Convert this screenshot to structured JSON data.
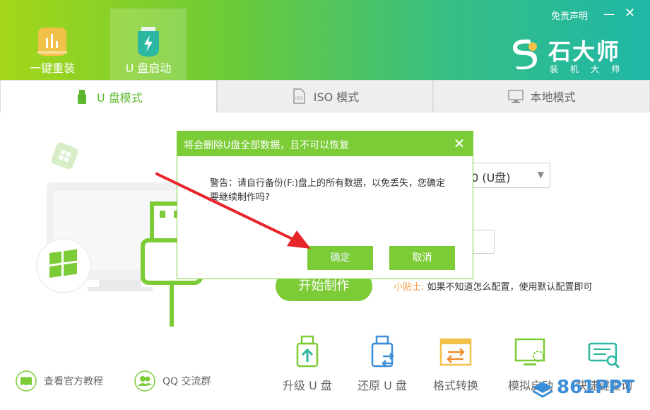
{
  "header": {
    "nav": [
      {
        "label": "一键重装",
        "icon": "bar-chart-icon"
      },
      {
        "label": "U 盘启动",
        "icon": "usb-lightning-icon"
      }
    ],
    "disclaimer": "免责声明",
    "minimize": "—",
    "close": "✕",
    "brand": {
      "name": "石大师",
      "sub": "装机大师"
    }
  },
  "tabs": [
    {
      "label": "U 盘模式",
      "icon": "usb-icon",
      "active": true
    },
    {
      "label": "ISO 模式",
      "icon": "iso-file-icon",
      "active": false
    },
    {
      "label": "本地模式",
      "icon": "monitor-icon",
      "active": false
    }
  ],
  "main": {
    "device_select": ".0 (U盘)",
    "start_button": "开始制作",
    "tip_label": "小贴士:",
    "tip_text": "如果不知道怎么配置，使用默认配置即可"
  },
  "bottom_links": [
    {
      "label": "查看官方教程",
      "icon": "book-icon"
    },
    {
      "label": "QQ 交流群",
      "icon": "group-icon"
    }
  ],
  "tools": [
    {
      "label": "升级 U 盘",
      "icon": "usb-upgrade-icon"
    },
    {
      "label": "还原 U 盘",
      "icon": "usb-restore-icon"
    },
    {
      "label": "格式转换",
      "icon": "format-convert-icon"
    },
    {
      "label": "模拟启动",
      "icon": "simulate-boot-icon"
    },
    {
      "label": "快捷键查询",
      "icon": "keyboard-search-icon"
    }
  ],
  "dialog": {
    "title": "将会删除U盘全部数据，且不可以恢复",
    "message": "警告：请自行备份(F:)盘上的所有数据，以免丢失，您确定要继续制作吗?",
    "ok": "确定",
    "cancel": "取消",
    "close": "✕"
  },
  "watermark": "861PPT",
  "colors": {
    "accent": "#7ccc37",
    "header_start": "#a4d61a",
    "header_end": "#1fb7a6",
    "tip": "#f4a24a",
    "arrow": "#e8252a"
  }
}
